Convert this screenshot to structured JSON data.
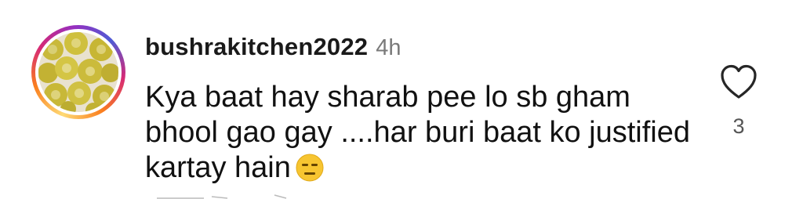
{
  "comment": {
    "username": "bushrakitchen2022",
    "timestamp": "4h",
    "text": "Kya baat hay sharab pee lo sb gham bhool gao gay ....har buri baat ko justified kartay hain",
    "emoji": "expressionless-face",
    "like_icon": "heart-outline-icon",
    "like_count": "3"
  },
  "colors": {
    "avatar_ring": [
      "#feda75",
      "#fa7e1e",
      "#d62976",
      "#962fbf",
      "#4f5bd5"
    ],
    "timestamp": "#7a7a7a",
    "emoji_face": "#f7c531"
  }
}
